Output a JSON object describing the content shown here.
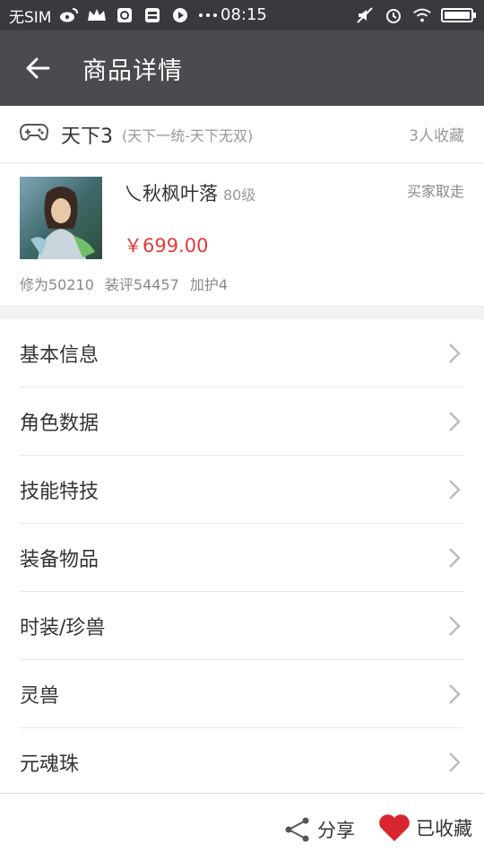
{
  "status_bar": {
    "carrier": "无SIM",
    "time": "08:15",
    "icons": [
      "weibo-icon",
      "crown-icon",
      "app-icon",
      "app-icon",
      "play-icon",
      "more-dots-icon"
    ],
    "right_icons": [
      "mute-icon",
      "alarm-icon",
      "wifi-icon",
      "battery-icon"
    ]
  },
  "toolbar": {
    "title": "商品详情",
    "back_icon": "back-arrow-icon"
  },
  "game": {
    "icon": "gamepad-icon",
    "name": "天下3",
    "server": "(天下一统-天下无双)",
    "favorites": "3人收藏"
  },
  "product": {
    "character_name": "乀秋枫叶落",
    "level": "80级",
    "seller_status": "买家取走",
    "price": "￥699.00",
    "stats": [
      "修为50210",
      "装评54457",
      "加护4"
    ]
  },
  "menu": [
    {
      "label": "基本信息"
    },
    {
      "label": "角色数据"
    },
    {
      "label": "技能特技"
    },
    {
      "label": "装备物品"
    },
    {
      "label": "时装/珍兽"
    },
    {
      "label": "灵兽"
    },
    {
      "label": "元魂珠"
    }
  ],
  "bottom_bar": {
    "share_label": "分享",
    "favorite_label": "已收藏"
  },
  "colors": {
    "status_bar": "#3a393e",
    "toolbar": "#4b4a4f",
    "price": "#e4393c",
    "heart": "#d9252f"
  }
}
